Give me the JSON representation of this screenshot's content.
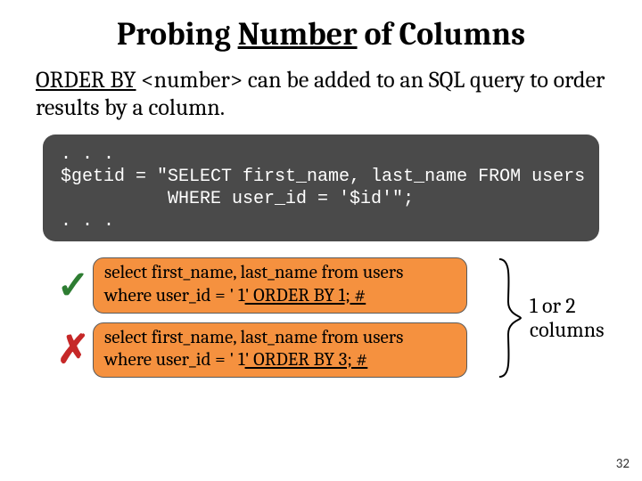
{
  "title": {
    "pre": "Probing ",
    "underlined": "Number",
    "post": " of Columns"
  },
  "desc": {
    "underlined": "ORDER BY",
    "plain1": " <number> can be added to an SQL query to order results by a column."
  },
  "code": {
    "line1": ". . .",
    "line2": "$getid = \"SELECT first_name, last_name FROM users",
    "line3": "          WHERE user_id = '$id'\";",
    "line4": ". . ."
  },
  "examples": [
    {
      "mark": "✓",
      "mark_name": "check-icon",
      "line1": "select first_name, last_name from users",
      "line2_pre": "where user_id = ' 1",
      "line2_ul": "' ORDER BY 1; #"
    },
    {
      "mark": "✗",
      "mark_name": "cross-icon",
      "line1": "select first_name, last_name from users",
      "line2_pre": "where user_id = ' 1",
      "line2_ul": "' ORDER BY 3; #"
    }
  ],
  "brace_label_line1": "1 or 2",
  "brace_label_line2": "columns",
  "page_number": "32"
}
